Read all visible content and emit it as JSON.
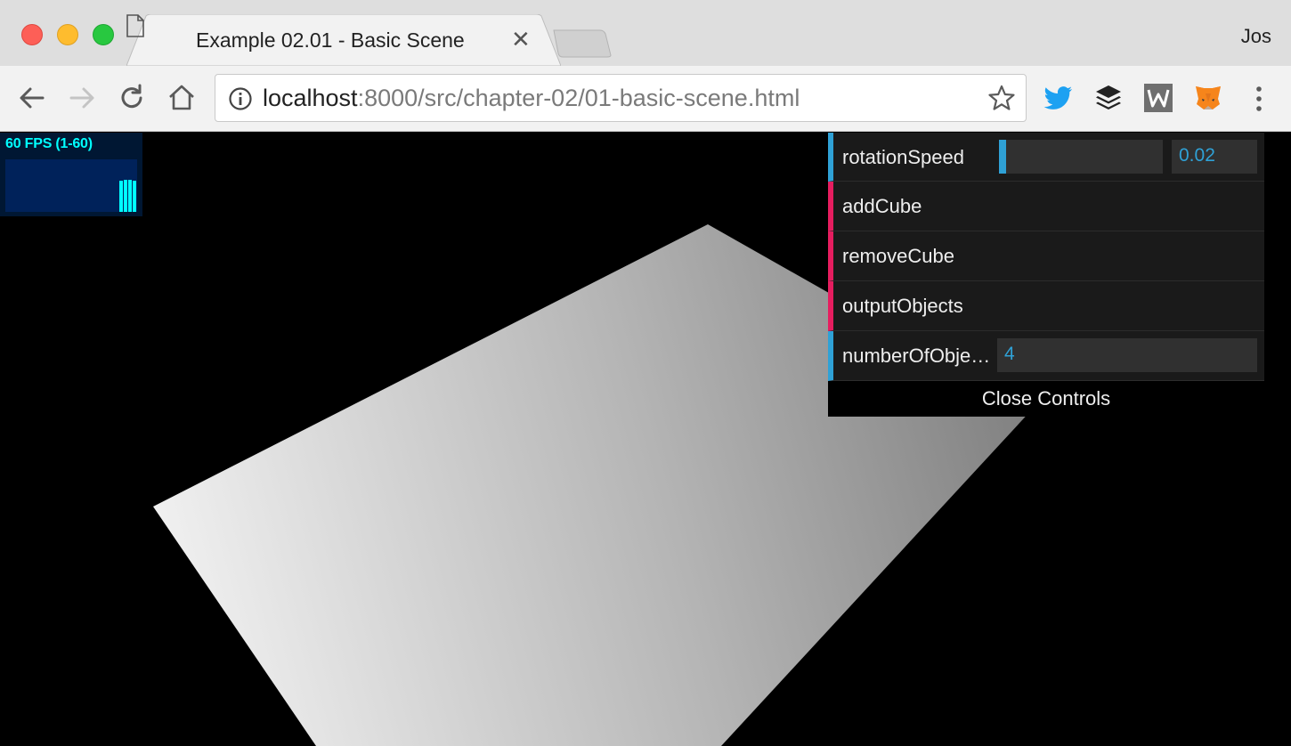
{
  "window": {
    "tab_title": "Example 02.01 - Basic Scene",
    "profile_name": "Jos"
  },
  "address_bar": {
    "host": "localhost",
    "rest": ":8000/src/chapter-02/01-basic-scene.html"
  },
  "extensions": [
    "twitter-icon",
    "buffer-icon",
    "w-icon",
    "metamask-fox-icon"
  ],
  "stats": {
    "fps_text": "60 FPS (1-60)",
    "fps_value": 60,
    "fps_min": 1,
    "fps_max": 60
  },
  "gui": {
    "rotation_speed": {
      "label": "rotationSpeed",
      "value": "0.02",
      "slider_fraction": 0.02
    },
    "add_cube_label": "addCube",
    "remove_cube_label": "removeCube",
    "output_objects_label": "outputObjects",
    "number_of_objects": {
      "label": "numberOfObjects",
      "value": "4"
    },
    "close_label": "Close Controls"
  },
  "colors": {
    "gui_number_accent": "#2fa1d6",
    "gui_function_accent": "#e61d5f",
    "fps_text": "#00ffff",
    "twitter": "#1da1f2"
  }
}
